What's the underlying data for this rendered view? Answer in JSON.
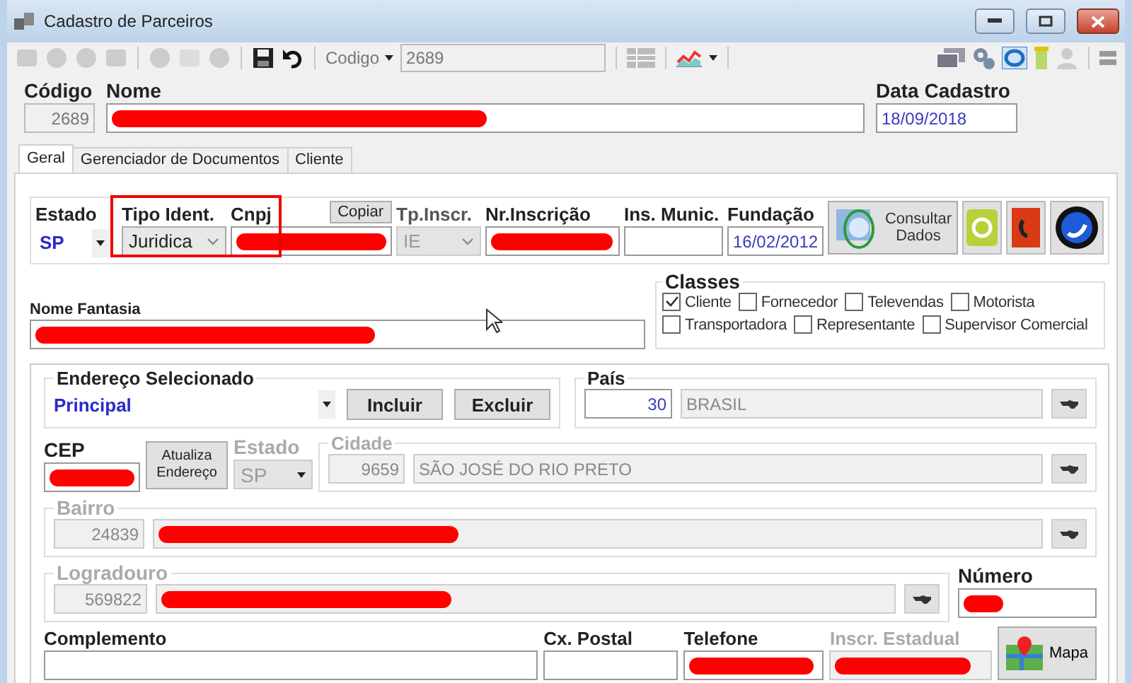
{
  "window": {
    "title": "Cadastro de Parceiros"
  },
  "toolbar": {
    "search_label": "Codigo",
    "search_value": "2689"
  },
  "header": {
    "codigo": {
      "label": "Código",
      "value": "2689"
    },
    "nome": {
      "label": "Nome",
      "redacted": true
    },
    "data_cadastro": {
      "label": "Data Cadastro",
      "value": "18/09/2018"
    }
  },
  "tabs": [
    {
      "label": "Geral",
      "selected": true
    },
    {
      "label": "Gerenciador de Documentos",
      "selected": false
    },
    {
      "label": "Cliente",
      "selected": false
    }
  ],
  "identificacao": {
    "estado": {
      "label": "Estado",
      "value": "SP"
    },
    "tipo_ident": {
      "label": "Tipo Ident.",
      "value": "Juridica"
    },
    "cnpj": {
      "label": "Cnpj",
      "redacted": true
    },
    "copy_button": "Copiar",
    "tp_inscr": {
      "label": "Tp.Inscr.",
      "value": "IE",
      "disabled": true
    },
    "nr_inscricao": {
      "label": "Nr.Inscrição",
      "redacted": true
    },
    "ins_munic": {
      "label": "Ins. Munic."
    },
    "fundacao": {
      "label": "Fundação",
      "value": "16/02/2012"
    },
    "consult_button": "Consultar Dados"
  },
  "nome_fantasia": {
    "label": "Nome Fantasia",
    "redacted": true
  },
  "classes": {
    "title": "Classes",
    "items": [
      {
        "label": "Cliente",
        "checked": true
      },
      {
        "label": "Fornecedor",
        "checked": false
      },
      {
        "label": "Televendas",
        "checked": false
      },
      {
        "label": "Motorista",
        "checked": false
      },
      {
        "label": "Transportadora",
        "checked": false
      },
      {
        "label": "Representante",
        "checked": false
      },
      {
        "label": "Supervisor Comercial",
        "checked": false
      }
    ]
  },
  "endereco": {
    "selecionado": {
      "label": "Endereço Selecionado",
      "value": "Principal"
    },
    "add_button": "Incluir",
    "delete_button": "Excluir",
    "pais": {
      "label": "País",
      "code": "30",
      "name": "BRASIL"
    },
    "cep": {
      "label": "CEP",
      "redacted": true
    },
    "update_button": "Atualiza Endereço",
    "estado": {
      "label": "Estado",
      "value": "SP",
      "disabled": true
    },
    "cidade": {
      "label": "Cidade",
      "code": "9659",
      "name": "SÃO JOSÉ DO RIO PRETO",
      "disabled": true
    },
    "bairro": {
      "label": "Bairro",
      "code": "24839",
      "redacted": true,
      "disabled": true
    },
    "logradouro": {
      "label": "Logradouro",
      "code": "569822",
      "redacted": true,
      "disabled": true
    },
    "numero": {
      "label": "Número",
      "redacted": true
    },
    "complemento": {
      "label": "Complemento"
    },
    "cx_postal": {
      "label": "Cx. Postal"
    },
    "telefone": {
      "label": "Telefone",
      "redacted": true
    },
    "inscr_estadual": {
      "label": "Inscr. Estadual",
      "redacted": true,
      "disabled": true
    },
    "map_button": "Mapa"
  }
}
